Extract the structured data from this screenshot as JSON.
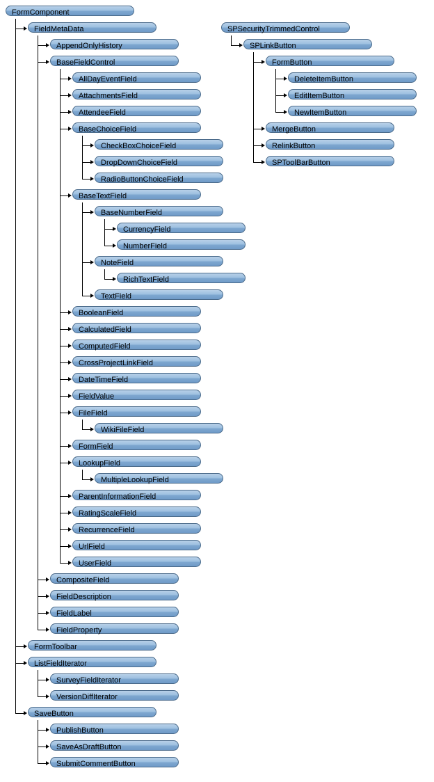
{
  "tree1": {
    "root": "FormComponent",
    "children": [
      {
        "label": "FieldMetaData",
        "children": [
          {
            "label": "AppendOnlyHistory"
          },
          {
            "label": "BaseFieldControl",
            "children": [
              {
                "label": "AllDayEventField"
              },
              {
                "label": "AttachmentsField"
              },
              {
                "label": "AttendeeField"
              },
              {
                "label": "BaseChoiceField",
                "children": [
                  {
                    "label": "CheckBoxChoiceField"
                  },
                  {
                    "label": "DropDownChoiceField"
                  },
                  {
                    "label": "RadioButtonChoiceField"
                  }
                ]
              },
              {
                "label": "BaseTextField",
                "children": [
                  {
                    "label": "BaseNumberField",
                    "children": [
                      {
                        "label": "CurrencyField"
                      },
                      {
                        "label": "NumberField"
                      }
                    ]
                  },
                  {
                    "label": "NoteField",
                    "children": [
                      {
                        "label": "RichTextField"
                      }
                    ]
                  },
                  {
                    "label": "TextField"
                  }
                ]
              },
              {
                "label": "BooleanField"
              },
              {
                "label": "CalculatedField"
              },
              {
                "label": "ComputedField"
              },
              {
                "label": "CrossProjectLinkField"
              },
              {
                "label": "DateTimeField"
              },
              {
                "label": "FieldValue"
              },
              {
                "label": "FileField",
                "children": [
                  {
                    "label": "WikiFileField"
                  }
                ]
              },
              {
                "label": "FormField"
              },
              {
                "label": "LookupField",
                "children": [
                  {
                    "label": "MultipleLookupField"
                  }
                ]
              },
              {
                "label": "ParentInformationField"
              },
              {
                "label": "RatingScaleField"
              },
              {
                "label": "RecurrenceField"
              },
              {
                "label": "UrlField"
              },
              {
                "label": "UserField"
              }
            ]
          },
          {
            "label": "CompositeField"
          },
          {
            "label": "FieldDescription"
          },
          {
            "label": "FieldLabel"
          },
          {
            "label": "FieldProperty"
          }
        ]
      },
      {
        "label": "FormToolbar"
      },
      {
        "label": "ListFieldIterator",
        "children": [
          {
            "label": "SurveyFieldIterator"
          },
          {
            "label": "VersionDiffIterator"
          }
        ]
      },
      {
        "label": "SaveButton",
        "children": [
          {
            "label": "PublishButton"
          },
          {
            "label": "SaveAsDraftButton"
          },
          {
            "label": "SubmitCommentButton"
          }
        ]
      }
    ]
  },
  "tree2": {
    "root": "SPSecurityTrimmedControl",
    "children": [
      {
        "label": "SPLinkButton",
        "children": [
          {
            "label": "FormButton",
            "children": [
              {
                "label": "DeleteItemButton"
              },
              {
                "label": "EditItemButton"
              },
              {
                "label": "NewItemButton"
              }
            ]
          },
          {
            "label": "MergeButton"
          },
          {
            "label": "RelinkButton"
          },
          {
            "label": "SPToolBarButton"
          }
        ]
      }
    ]
  }
}
